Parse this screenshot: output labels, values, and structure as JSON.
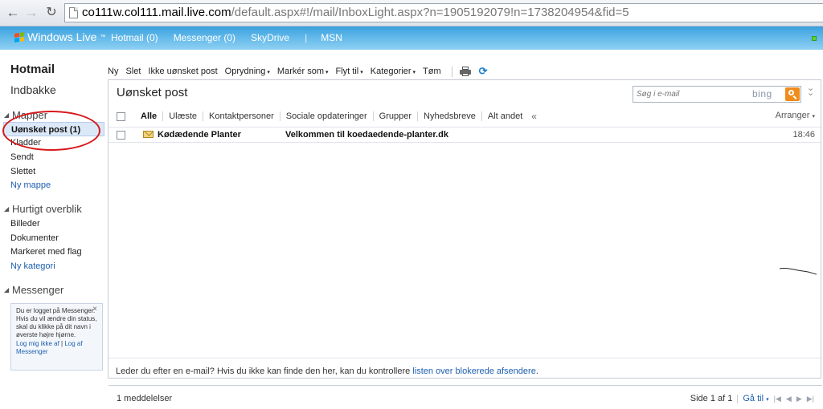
{
  "browser": {
    "url_host": "co111w.col111.mail.live.com",
    "url_path": "/default.aspx#!/mail/InboxLight.aspx?n=1905192079!n=1738204954&fid=5"
  },
  "header": {
    "brand": "Windows Live",
    "tm": "™",
    "nav": [
      "Hotmail (0)",
      "Messenger (0)",
      "SkyDrive",
      "MSN"
    ],
    "separator": "|"
  },
  "sidebar": {
    "title": "Hotmail",
    "inbox": "Indbakke",
    "folders_heading": "Mapper",
    "folders": [
      {
        "label": "Uønsket post (1)"
      },
      {
        "label": "Kladder"
      },
      {
        "label": "Sendt"
      },
      {
        "label": "Slettet"
      }
    ],
    "new_folder": "Ny mappe",
    "quick_heading": "Hurtigt overblik",
    "quick_items": [
      "Billeder",
      "Dokumenter",
      "Markeret med flag"
    ],
    "new_category": "Ny kategori",
    "messenger_heading": "Messenger",
    "messenger_text": "Du er logget på Messenger. Hvis du vil ændre din status, skal du klikke på dit navn i øverste højre hjørne.",
    "messenger_logout": "Log mig ikke af",
    "messenger_pipe": "|",
    "messenger_signout": "Log af Messenger",
    "close_glyph": "×"
  },
  "toolbar": {
    "items": [
      {
        "label": "Ny",
        "dropdown": false
      },
      {
        "label": "Slet",
        "dropdown": false
      },
      {
        "label": "Ikke uønsket post",
        "dropdown": false
      },
      {
        "label": "Oprydning",
        "dropdown": true
      },
      {
        "label": "Markér som",
        "dropdown": true
      },
      {
        "label": "Flyt til",
        "dropdown": true
      },
      {
        "label": "Kategorier",
        "dropdown": true
      },
      {
        "label": "Tøm",
        "dropdown": false
      }
    ],
    "dropdown_glyph": "▾"
  },
  "folder_view": {
    "title": "Uønsket post",
    "search_placeholder": "Søg i e-mail",
    "search_brand": "bing",
    "filters": [
      "Alle",
      "Ulæste",
      "Kontaktpersoner",
      "Sociale opdateringer",
      "Grupper",
      "Nyhedsbreve",
      "Alt andet"
    ],
    "filters_more": "«",
    "arrange": "Arranger",
    "messages": [
      {
        "from": "Kødædende Planter",
        "subject": "Velkommen til koedaedende-planter.dk",
        "time": "18:46"
      }
    ],
    "blocked_text": "Leder du efter en e-mail? Hvis du ikke kan finde den her, kan du kontrollere ",
    "blocked_link": "listen over blokerede afsendere",
    "blocked_end": ".",
    "count_text": "1 meddelelser",
    "page_text": "Side 1 af 1",
    "goto": "Gå til"
  },
  "colors": {
    "header_blue": "#3aa0dd",
    "link_blue": "#1e5fb0",
    "selection": "#dbe8f8",
    "annotation_red": "#d7191c",
    "search_orange": "#f08c1c"
  }
}
